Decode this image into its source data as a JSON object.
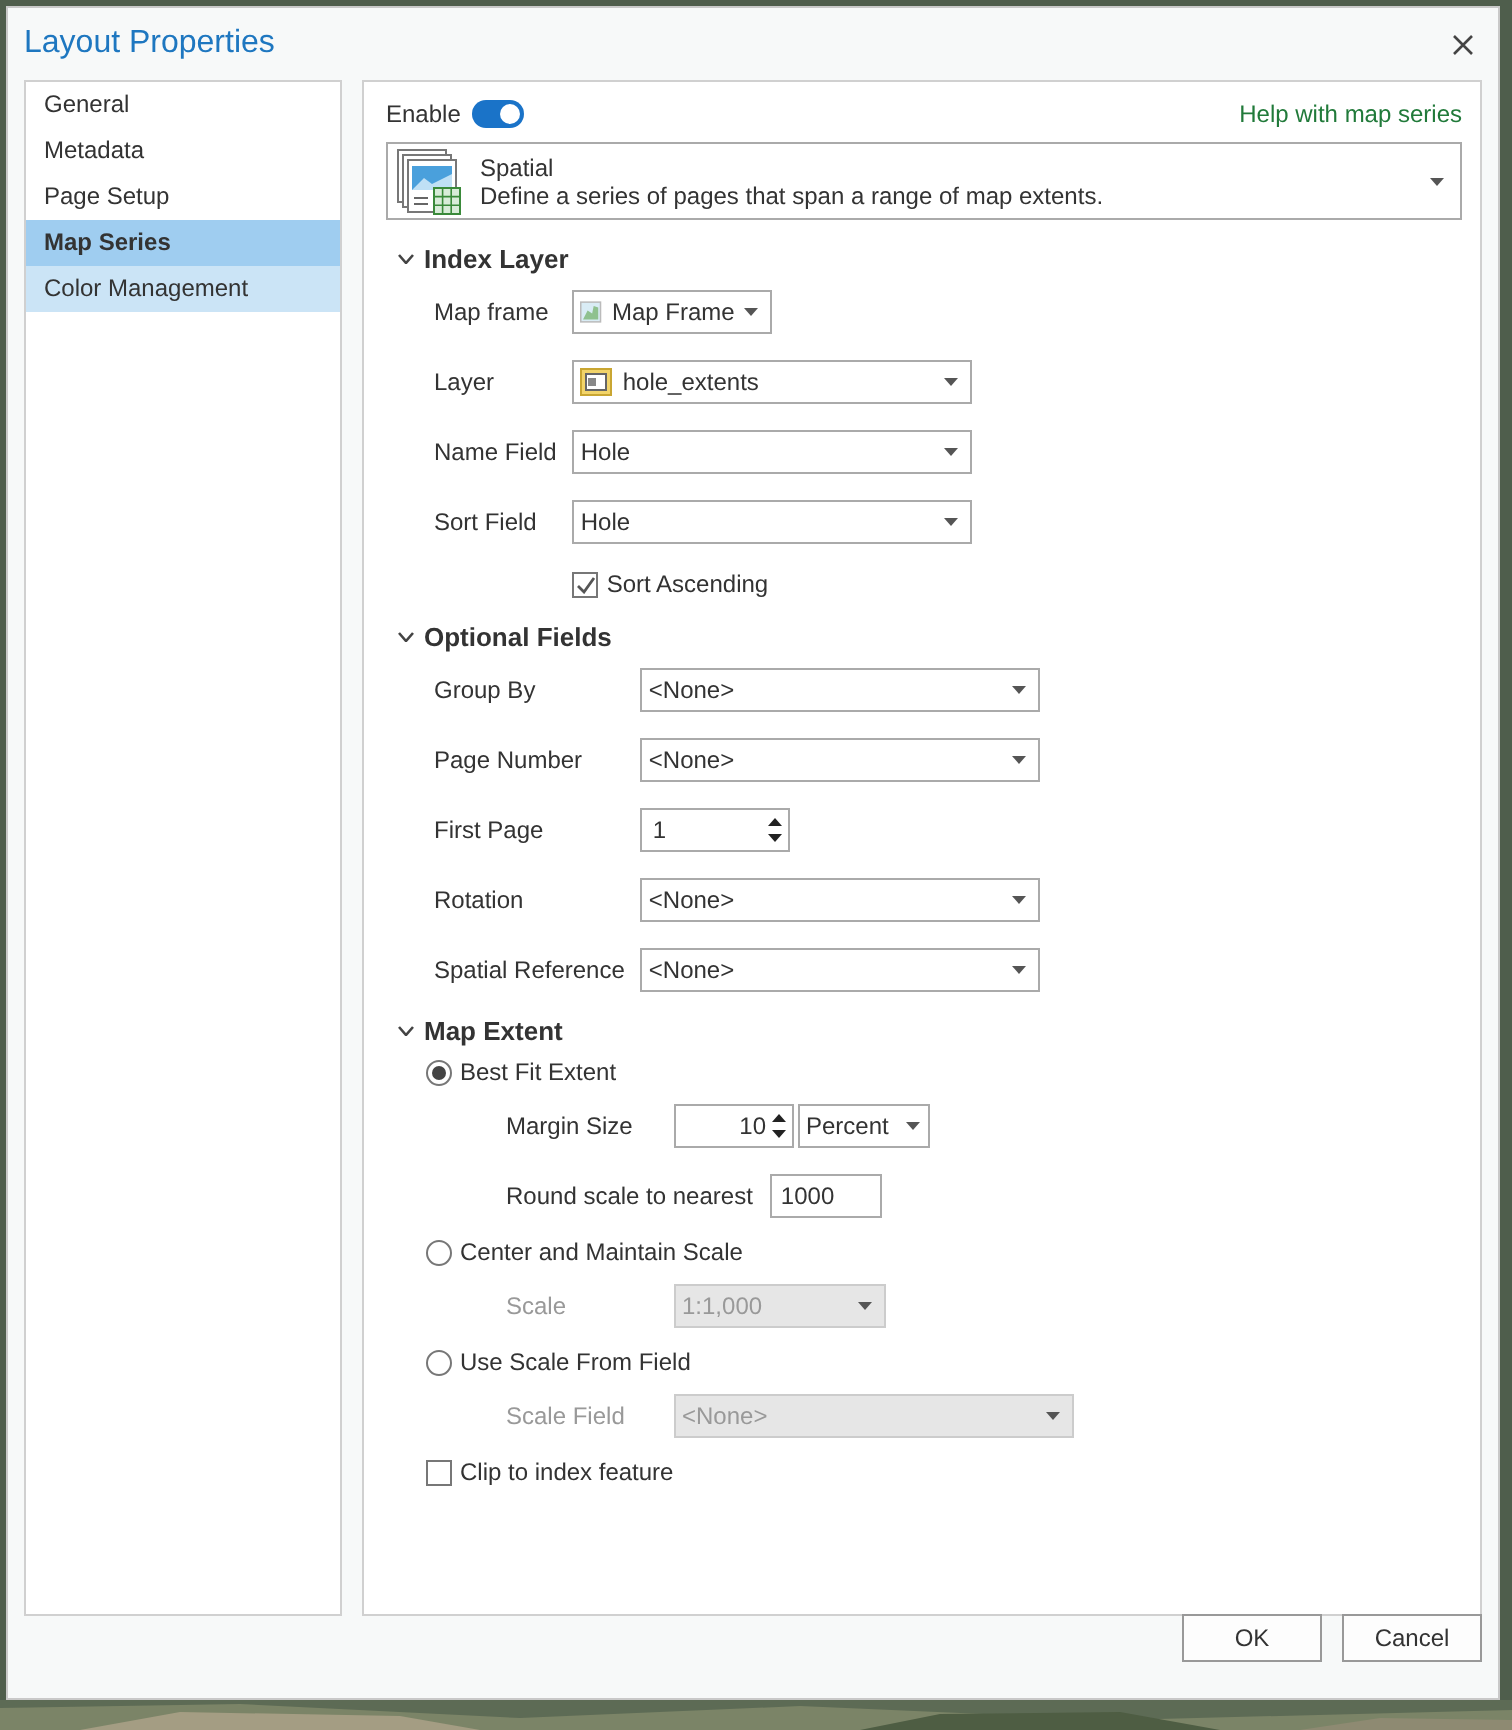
{
  "window": {
    "title": "Layout Properties"
  },
  "sidebar": {
    "items": [
      {
        "label": "General",
        "selected": false,
        "hovered": false
      },
      {
        "label": "Metadata",
        "selected": false,
        "hovered": false
      },
      {
        "label": "Page Setup",
        "selected": false,
        "hovered": false
      },
      {
        "label": "Map Series",
        "selected": true,
        "hovered": false
      },
      {
        "label": "Color Management",
        "selected": false,
        "hovered": true
      }
    ]
  },
  "enable": {
    "label": "Enable",
    "on": true
  },
  "help_link": "Help with map series",
  "series_type": {
    "title": "Spatial",
    "description": "Define a series of pages that span a range of map extents."
  },
  "sections": [
    {
      "title": "Index Layer",
      "expanded": true,
      "rows": [
        {
          "kind": "frame-select",
          "label": "Map frame",
          "value": "Map Frame"
        },
        {
          "kind": "layer-select",
          "label": "Layer",
          "value": "hole_extents"
        },
        {
          "kind": "dropdown",
          "label": "Name Field",
          "value": "Hole"
        },
        {
          "kind": "dropdown",
          "label": "Sort Field",
          "value": "Hole"
        },
        {
          "kind": "checkbox",
          "label": "Sort Ascending",
          "checked": true
        }
      ]
    },
    {
      "title": "Optional Fields",
      "expanded": true,
      "rows": [
        {
          "kind": "dropdown",
          "label": "Group By",
          "value": "<None>"
        },
        {
          "kind": "dropdown",
          "label": "Page Number",
          "value": "<None>"
        },
        {
          "kind": "spinner",
          "label": "First Page",
          "value": "1"
        },
        {
          "kind": "dropdown",
          "label": "Rotation",
          "value": "<None>"
        },
        {
          "kind": "dropdown",
          "label": "Spatial Reference",
          "value": "<None>"
        }
      ]
    },
    {
      "title": "Map Extent",
      "expanded": true,
      "options": [
        {
          "kind": "radio",
          "label": "Best Fit Extent",
          "selected": true,
          "rows": [
            {
              "kind": "spinner-unit",
              "label": "Margin Size",
              "value": "10",
              "unit": "Percent"
            },
            {
              "kind": "text",
              "label": "Round scale to nearest",
              "value": "1000"
            }
          ]
        },
        {
          "kind": "radio",
          "label": "Center and Maintain Scale",
          "selected": false,
          "rows": [
            {
              "kind": "scale-select",
              "label": "Scale",
              "value": "1:1,000",
              "disabled": true
            }
          ]
        },
        {
          "kind": "radio",
          "label": "Use Scale From Field",
          "selected": false,
          "rows": [
            {
              "kind": "dropdown",
              "label": "Scale Field",
              "value": "<None>",
              "disabled": true
            }
          ]
        },
        {
          "kind": "checkbox",
          "label": "Clip to index feature",
          "checked": false
        }
      ]
    }
  ],
  "buttons": [
    "OK",
    "Cancel"
  ]
}
